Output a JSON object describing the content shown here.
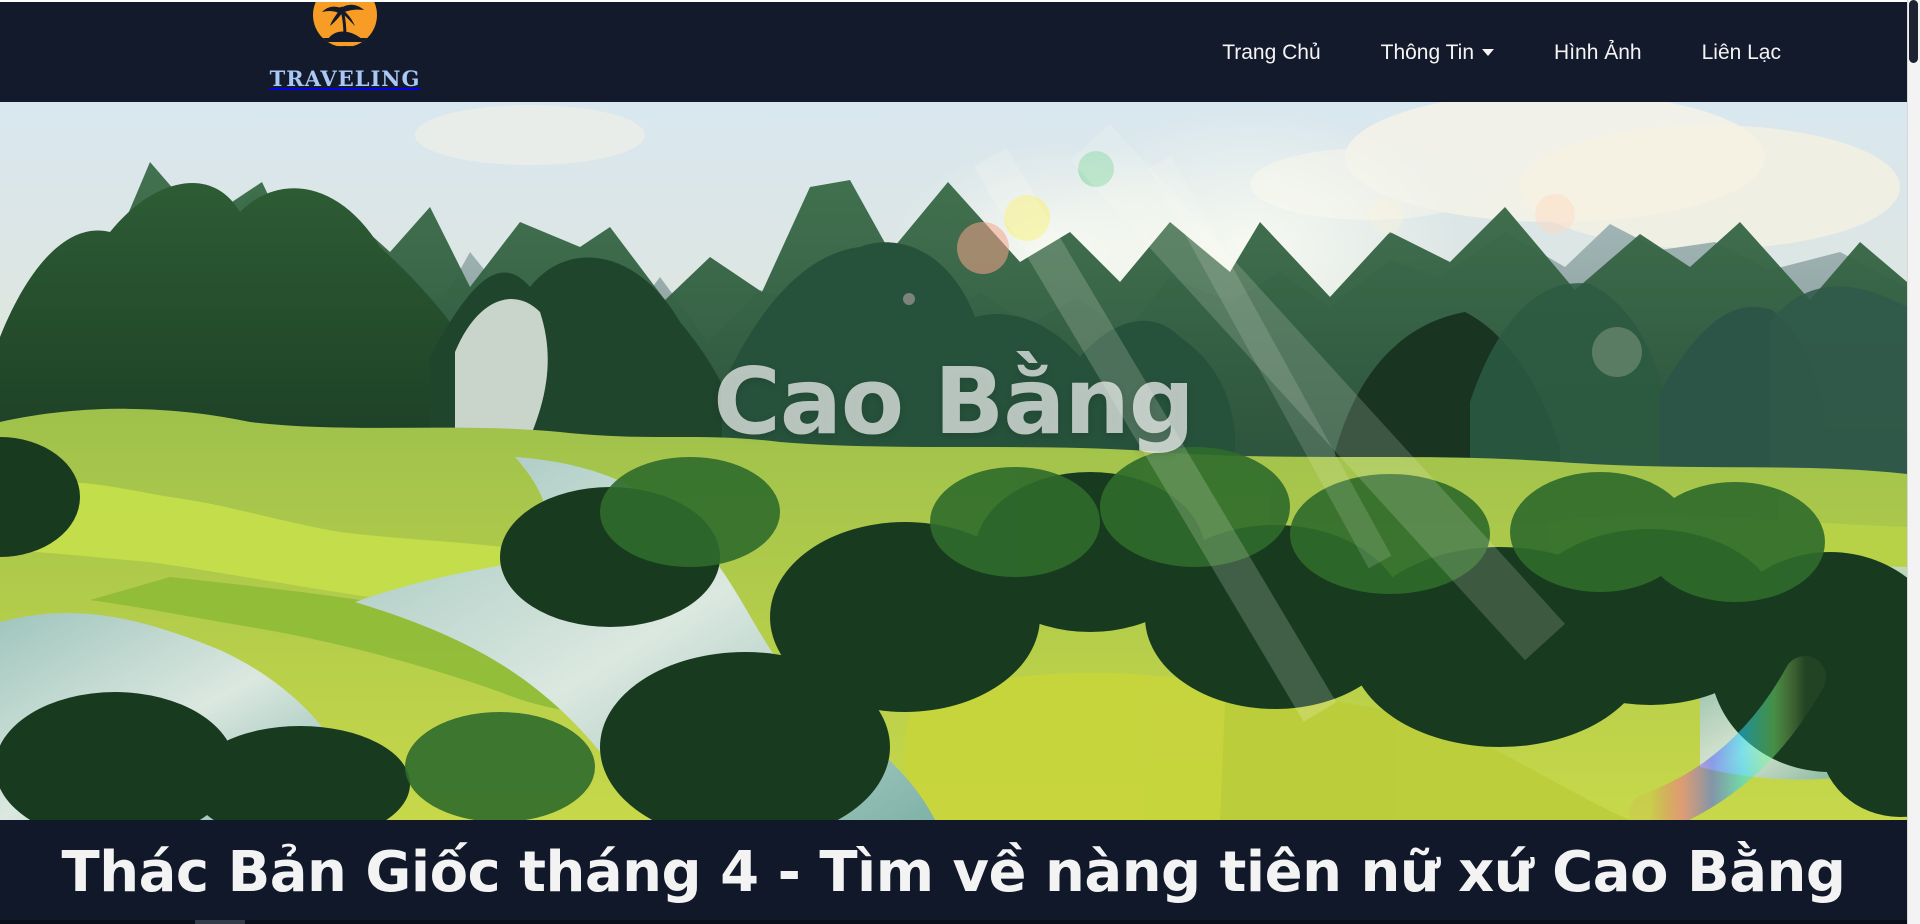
{
  "brand": {
    "text": "TRAVELING",
    "logo_icon": "palm-sunset-icon"
  },
  "nav": {
    "items": [
      {
        "label": "Trang Chủ",
        "has_dropdown": false
      },
      {
        "label": "Thông Tin",
        "has_dropdown": true
      },
      {
        "label": "Hình Ảnh",
        "has_dropdown": false
      },
      {
        "label": "Liên Lạc",
        "has_dropdown": false
      }
    ]
  },
  "hero": {
    "title": "Cao Bằng",
    "image_icon": "landscape-image"
  },
  "caption": {
    "text": "Thác Bản Giốc tháng 4 - Tìm về nàng tiên nữ xứ Cao Bằng"
  },
  "colors": {
    "nav_background": "#131a2b",
    "caption_background": "#10182a",
    "brand_text": "#a9c8f5",
    "logo_orange": "#f79c24",
    "hero_green": "#7fa654"
  }
}
